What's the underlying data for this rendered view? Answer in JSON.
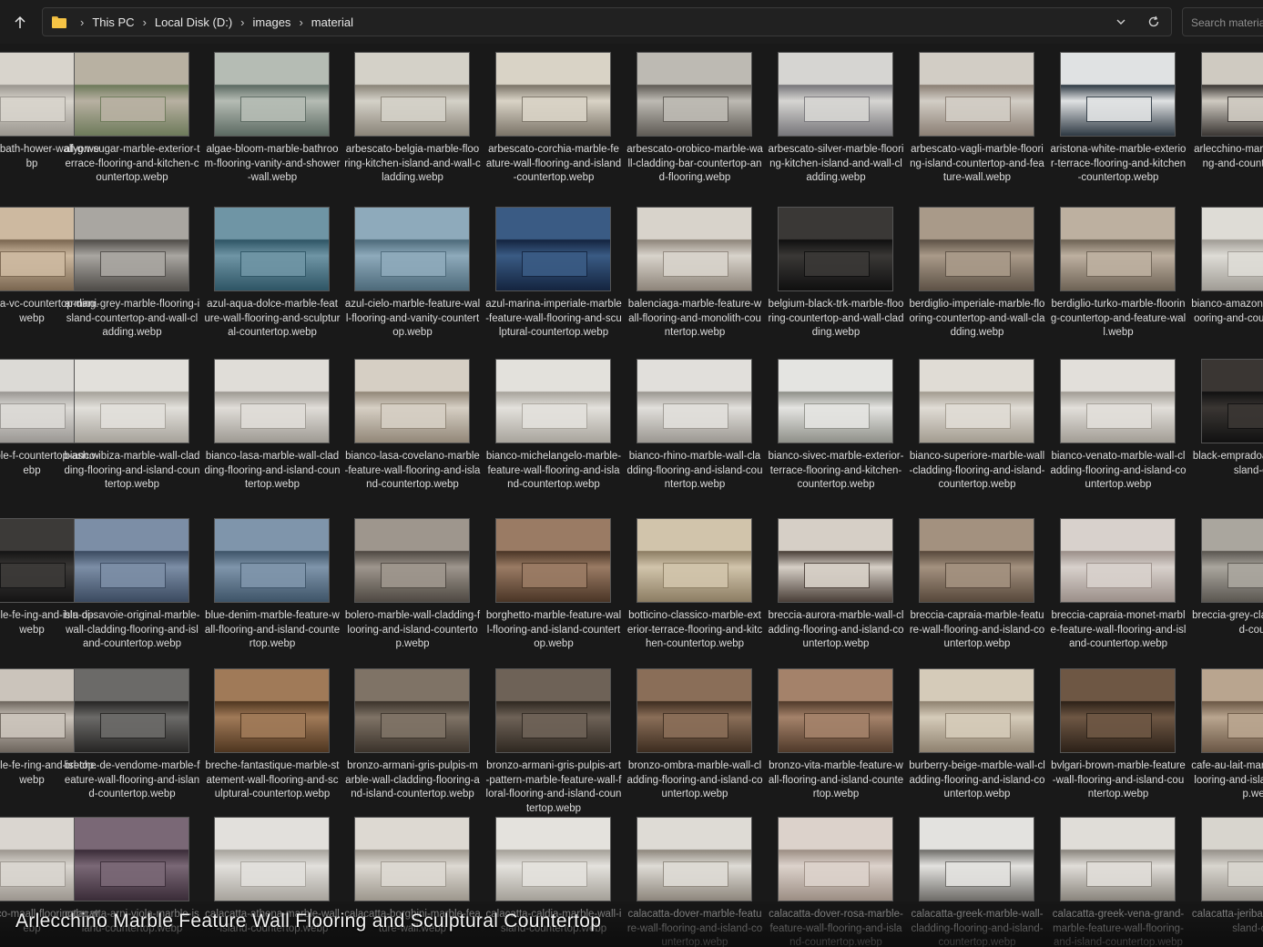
{
  "address_bar": {
    "folder_icon": "folder-icon",
    "breadcrumbs": [
      "This PC",
      "Local Disk (D:)",
      "images",
      "material"
    ]
  },
  "search": {
    "placeholder": "Search materia"
  },
  "caption": "Arlecchino Marble Feature Wall Flooring and Sculptural Countertop",
  "colors": {
    "background": "#191919",
    "folder": "#f6c445",
    "text": "#e6e6e6"
  },
  "rows": [
    [
      {
        "name": "marble-bath-hower-wall-g.webp",
        "palette": [
          "#d8d4cc",
          "#9a968f"
        ]
      },
      {
        "name": "afyon-sugar-marble-exterior-terrace-flooring-and-kitchen-countertop.webp",
        "palette": [
          "#b8b1a2",
          "#6d7a5a"
        ]
      },
      {
        "name": "algae-bloom-marble-bathroom-flooring-vanity-and-shower-wall.webp",
        "palette": [
          "#b5bcb4",
          "#5c6a62"
        ]
      },
      {
        "name": "arbescato-belgia-marble-flooring-kitchen-island-and-wall-cladding.webp",
        "palette": [
          "#d4d1c8",
          "#8a8478"
        ]
      },
      {
        "name": "arbescato-corchia-marble-feature-wall-flooring-and-island-countertop.webp",
        "palette": [
          "#d9d3c6",
          "#7b7468"
        ]
      },
      {
        "name": "arbescato-orobico-marble-wall-cladding-bar-countertop-and-flooring.webp",
        "palette": [
          "#bdbab3",
          "#5f5b55"
        ]
      },
      {
        "name": "arbescato-silver-marble-flooring-kitchen-island-and-wall-cladding.webp",
        "palette": [
          "#d6d5d2",
          "#77767a"
        ]
      },
      {
        "name": "arbescato-vagli-marble-flooring-island-countertop-and-feature-wall.webp",
        "palette": [
          "#d2cdc5",
          "#8b7f74"
        ]
      },
      {
        "name": "aristona-white-marble-exterior-terrace-flooring-and-kitchen-countertop.webp",
        "palette": [
          "#e0e2e3",
          "#2f3a44"
        ]
      },
      {
        "name": "arlecchino-marble-wall-flooring-and-countertop.webp",
        "palette": [
          "#cfcac1",
          "#3b3734"
        ]
      }
    ],
    [
      {
        "name": "eramosa-vc-countertop-ding.webp",
        "palette": [
          "#cdb9a0",
          "#7a6650"
        ]
      },
      {
        "name": "armani-grey-marble-flooring-island-countertop-and-wall-cladding.webp",
        "palette": [
          "#a9a6a1",
          "#4f4c48"
        ]
      },
      {
        "name": "azul-aqua-dolce-marble-feature-wall-flooring-and-sculptural-countertop.webp",
        "palette": [
          "#6f95a5",
          "#2e5565"
        ]
      },
      {
        "name": "azul-cielo-marble-feature-wall-flooring-and-vanity-countertop.webp",
        "palette": [
          "#8eaabb",
          "#4d6a7a"
        ]
      },
      {
        "name": "azul-marina-imperiale-marble-feature-wall-flooring-and-sculptural-countertop.webp",
        "palette": [
          "#3a5b84",
          "#14243f"
        ]
      },
      {
        "name": "balenciaga-marble-feature-wall-flooring-and-monolith-countertop.webp",
        "palette": [
          "#d8d3cb",
          "#8e857a"
        ]
      },
      {
        "name": "belgium-black-trk-marble-flooring-countertop-and-wall-cladding.webp",
        "palette": [
          "#3a3836",
          "#0f0f0f"
        ]
      },
      {
        "name": "berdiglio-imperiale-marble-flooring-countertop-and-wall-cladding.webp",
        "palette": [
          "#a99a89",
          "#5e5246"
        ]
      },
      {
        "name": "berdiglio-turko-marble-flooring-countertop-and-feature-wall.webp",
        "palette": [
          "#bdb0a0",
          "#6e6355"
        ]
      },
      {
        "name": "bianco-amazonico-cladding-flooring-and-countertop.webp",
        "palette": [
          "#dedcd6",
          "#a09c95"
        ]
      }
    ],
    [
      {
        "name": "te-marble-f-countertop-ash.webp",
        "palette": [
          "#dcdad6",
          "#9a9793"
        ]
      },
      {
        "name": "bianco-ibiza-marble-wall-cladding-flooring-and-island-countertop.webp",
        "palette": [
          "#e2e0db",
          "#a6a29a"
        ]
      },
      {
        "name": "bianco-lasa-marble-wall-cladding-flooring-and-island-countertop.webp",
        "palette": [
          "#e0ddd8",
          "#9e9a93"
        ]
      },
      {
        "name": "bianco-lasa-covelano-marble-feature-wall-flooring-and-island-countertop.webp",
        "palette": [
          "#d6cfc4",
          "#928778"
        ]
      },
      {
        "name": "bianco-michelangelo-marble-feature-wall-flooring-and-island-countertop.webp",
        "palette": [
          "#e3e1dc",
          "#a8a49c"
        ]
      },
      {
        "name": "bianco-rhino-marble-wall-cladding-flooring-and-island-countertop.webp",
        "palette": [
          "#e1dfdb",
          "#9b9791"
        ]
      },
      {
        "name": "bianco-sivec-marble-exterior-terrace-flooring-and-kitchen-countertop.webp",
        "palette": [
          "#e4e4e1",
          "#8f9089"
        ]
      },
      {
        "name": "bianco-superiore-marble-wall-cladding-flooring-and-island-countertop.webp",
        "palette": [
          "#e0dcd5",
          "#a39c90"
        ]
      },
      {
        "name": "bianco-venato-marble-wall-cladding-flooring-and-island-countertop.webp",
        "palette": [
          "#e2dfda",
          "#a29d95"
        ]
      },
      {
        "name": "black-empradoall-cladding-flisland-coun",
        "palette": [
          "#3a3633",
          "#111111"
        ]
      }
    ],
    [
      {
        "name": "a-marble-fe-ing-and-isla-op.webp",
        "palette": [
          "#3c3a38",
          "#141414"
        ]
      },
      {
        "name": "blu-di-savoie-original-marble-wall-cladding-flooring-and-island-countertop.webp",
        "palette": [
          "#7c8ea6",
          "#3b4a60"
        ]
      },
      {
        "name": "blue-denim-marble-feature-wall-flooring-and-island-countertop.webp",
        "palette": [
          "#7f95ab",
          "#3e5468"
        ]
      },
      {
        "name": "bolero-marble-wall-cladding-flooring-and-island-countertop.webp",
        "palette": [
          "#9e968d",
          "#4e4842"
        ]
      },
      {
        "name": "borghetto-marble-feature-wall-flooring-and-island-countertop.webp",
        "palette": [
          "#9a7b64",
          "#4a3526"
        ]
      },
      {
        "name": "botticino-classico-marble-exterior-terrace-flooring-and-kitchen-countertop.webp",
        "palette": [
          "#d1c4ab",
          "#8c7d63"
        ]
      },
      {
        "name": "breccia-aurora-marble-wall-cladding-flooring-and-island-countertop.webp",
        "palette": [
          "#d6cfc6",
          "#4a3f38"
        ]
      },
      {
        "name": "breccia-capraia-marble-feature-wall-flooring-and-island-countertop.webp",
        "palette": [
          "#a3917f",
          "#57483b"
        ]
      },
      {
        "name": "breccia-capraia-monet-marble-feature-wall-flooring-and-island-countertop.webp",
        "palette": [
          "#d8d1cc",
          "#9b8f89"
        ]
      },
      {
        "name": "breccia-grey-cladding-flooland-counte",
        "palette": [
          "#aaa69e",
          "#5a5650"
        ]
      }
    ],
    [
      {
        "name": "a-marble-fe-ring-and-isl-top.webp",
        "palette": [
          "#cbc4bb",
          "#6d655d"
        ]
      },
      {
        "name": "breche-de-vendome-marble-feature-wall-flooring-and-island-countertop.webp",
        "palette": [
          "#6b6a68",
          "#262524"
        ]
      },
      {
        "name": "breche-fantastique-marble-statement-wall-flooring-and-sculptural-countertop.webp",
        "palette": [
          "#a07a58",
          "#4f3620"
        ]
      },
      {
        "name": "bronzo-armani-gris-pulpis-marble-wall-cladding-flooring-and-island-countertop.webp",
        "palette": [
          "#7f7366",
          "#3b332b"
        ]
      },
      {
        "name": "bronzo-armani-gris-pulpis-art-pattern-marble-feature-wall-floral-flooring-and-island-countertop.webp",
        "palette": [
          "#6e6257",
          "#2f2821"
        ]
      },
      {
        "name": "bronzo-ombra-marble-wall-cladding-flooring-and-island-countertop.webp",
        "palette": [
          "#8a6e58",
          "#3d2d20"
        ]
      },
      {
        "name": "bronzo-vita-marble-feature-wall-flooring-and-island-countertop.webp",
        "palette": [
          "#a4826a",
          "#503a2a"
        ]
      },
      {
        "name": "burberry-beige-marble-wall-cladding-flooring-and-island-countertop.webp",
        "palette": [
          "#d5cbb9",
          "#8f8270"
        ]
      },
      {
        "name": "bvlgari-brown-marble-feature-wall-flooring-and-island-countertop.webp",
        "palette": [
          "#6e5744",
          "#2c2118"
        ]
      },
      {
        "name": "cafe-au-lait-marble-cladding-flooring-and-island-countertop.webp",
        "palette": [
          "#b9a58f",
          "#6a5745"
        ]
      }
    ],
    [
      {
        "name": "antastico-maall-flooringtop.webp",
        "palette": [
          "#dad6d0",
          "#9c968f"
        ]
      },
      {
        "name": "calacatta-arni-viola-marble-island-countertop.webp",
        "palette": [
          "#7a6876",
          "#3a2c38"
        ]
      },
      {
        "name": "calacatta-athena-marble-wall-island-countertop.webp",
        "palette": [
          "#e2e0dc",
          "#a7a39c"
        ]
      },
      {
        "name": "calacatta-borghini-marble-feature-wall.webp",
        "palette": [
          "#ddd9d2",
          "#9d978d"
        ]
      },
      {
        "name": "calacatta-caldia-marble-wall-island-countertop.webp",
        "palette": [
          "#e4e2dd",
          "#a4a098"
        ]
      },
      {
        "name": "calacatta-dover-marble-feature-wall-flooring-and-island-countertop.webp",
        "palette": [
          "#dedbd5",
          "#8e877d"
        ]
      },
      {
        "name": "calacatta-dover-rosa-marble-feature-wall-flooring-and-island-countertop.webp",
        "palette": [
          "#dcd2cb",
          "#9c8e84"
        ]
      },
      {
        "name": "calacatta-greek-marble-wall-cladding-flooring-and-island-countertop.webp",
        "palette": [
          "#e3e2df",
          "#6f6d69"
        ]
      },
      {
        "name": "calacatta-greek-vena-grand-marble-feature-wall-flooring-and-island-countertop.webp",
        "palette": [
          "#e0ddd8",
          "#8a857d"
        ]
      },
      {
        "name": "calacatta-jeribaoll-cladding-flisland-count",
        "palette": [
          "#d8d5ce",
          "#96918a"
        ]
      }
    ]
  ]
}
